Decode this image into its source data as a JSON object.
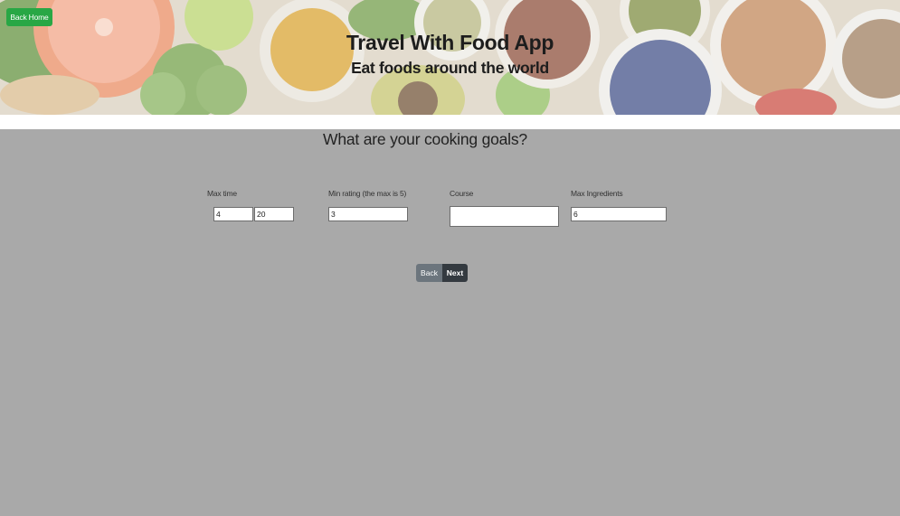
{
  "header": {
    "back_home_label": "Back Home",
    "title": "Travel With Food App",
    "subtitle": "Eat foods around the world"
  },
  "form": {
    "question": "What are your cooking goals?",
    "max_time": {
      "label": "Max time",
      "min_value": "4",
      "max_value": "20"
    },
    "min_rating": {
      "label": "Min rating (the max is 5)",
      "value": "3"
    },
    "course": {
      "label": "Course",
      "selected": ""
    },
    "max_ingredients": {
      "label": "Max Ingredients",
      "value": "6"
    }
  },
  "nav": {
    "back_label": "Back",
    "next_label": "Next"
  },
  "colors": {
    "success": "#28a745",
    "secondary": "#6c757d",
    "dark": "#343a40",
    "main_background": "#a9a9a9"
  },
  "icons": {
    "banner_image": "food-ingredients-photo"
  }
}
